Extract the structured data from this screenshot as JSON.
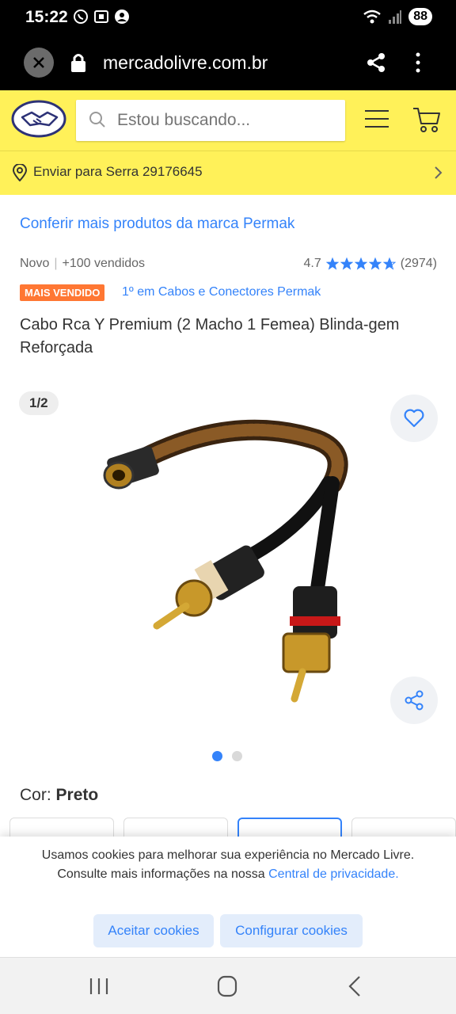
{
  "status_bar": {
    "time": "15:22",
    "battery": "88",
    "icons": [
      "whatsapp-icon",
      "screenshot-icon",
      "account-icon",
      "wifi-icon",
      "signal-icon"
    ]
  },
  "browser": {
    "url": "mercadolivre.com.br",
    "icons": [
      "close-icon",
      "lock-icon",
      "share-icon",
      "more-vertical-icon"
    ]
  },
  "header": {
    "search_placeholder": "Estou buscando...",
    "brand_color": "#fff159",
    "icons": [
      "mercadolivre-logo",
      "search-icon",
      "menu-icon",
      "cart-icon"
    ]
  },
  "shipping": {
    "text": "Enviar para Serra 29176645"
  },
  "product": {
    "brand_link": "Conferir mais produtos da marca Permak",
    "condition": "Novo",
    "sold": "+100 vendidos",
    "rating": "4.7",
    "star_rating": 4.7,
    "reviews": "(2974)",
    "badge": "MAIS VENDIDO",
    "badge_color": "#ff7733",
    "rank": "1º em Cabos e Conectores Permak",
    "title": "Cabo Rca Y Premium (2 Macho 1 Femea) Blinda-gem Reforçada",
    "image_pager": "1/2",
    "current_image": 1,
    "image_count": 2,
    "color_label": "Cor: ",
    "color_value": "Preto",
    "swatch_count": 4,
    "selected_swatch": 3
  },
  "cookie": {
    "text": "Usamos cookies para melhorar sua experiência no Mercado Livre. Consulte mais informações na nossa ",
    "link": "Central de privacidade.",
    "accept": "Aceitar cookies",
    "configure": "Configurar cookies",
    "link_color": "#3483fa"
  },
  "nav": {
    "icons": [
      "recent-apps-icon",
      "home-icon",
      "back-icon"
    ]
  }
}
